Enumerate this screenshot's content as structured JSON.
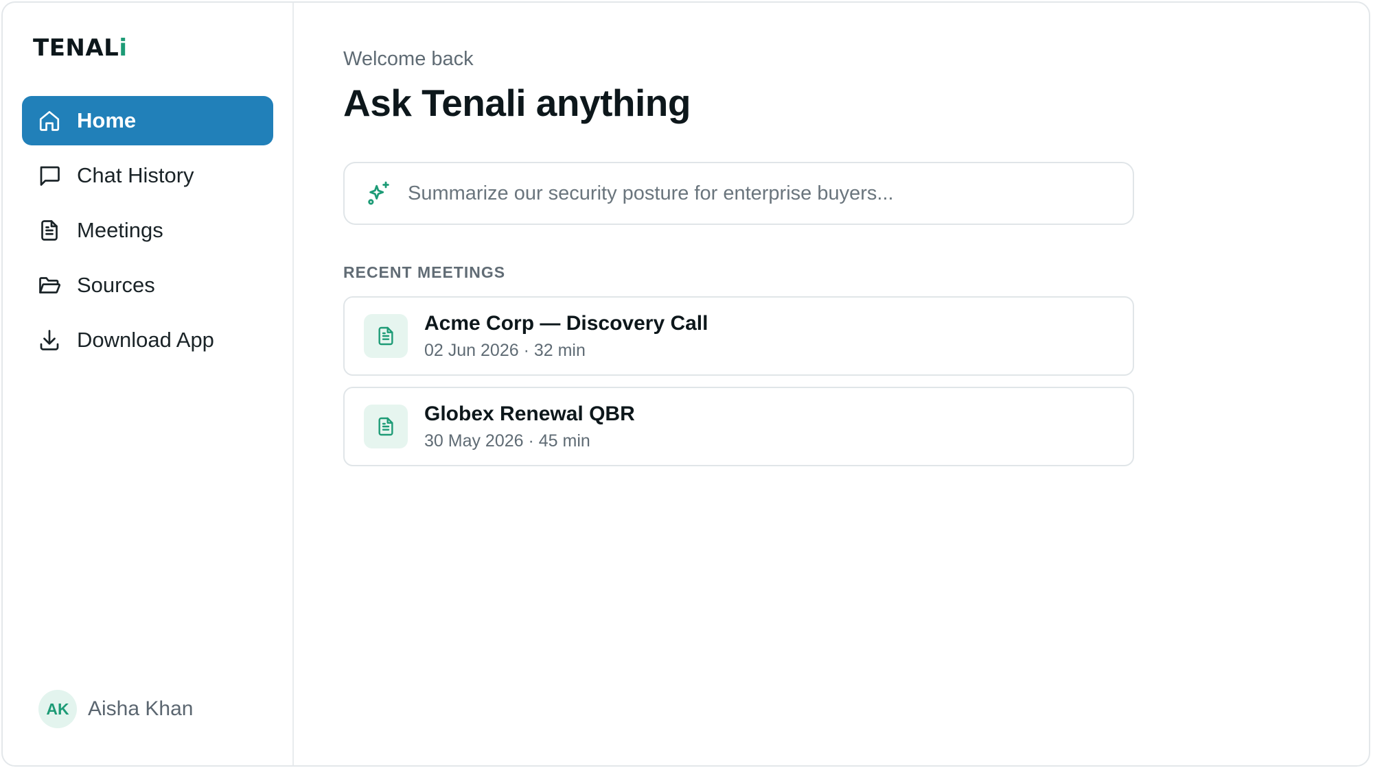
{
  "logo": {
    "text": "TENAL",
    "accent": "i"
  },
  "sidebar": {
    "items": [
      {
        "label": "Home",
        "icon": "home-icon",
        "active": true
      },
      {
        "label": "Chat History",
        "icon": "chat-icon"
      },
      {
        "label": "Meetings",
        "icon": "document-icon"
      },
      {
        "label": "Sources",
        "icon": "folder-icon"
      },
      {
        "label": "Download App",
        "icon": "download-icon"
      }
    ]
  },
  "user": {
    "initials": "AK",
    "name": "Aisha Khan"
  },
  "main": {
    "welcome": "Welcome back",
    "title": "Ask Tenali anything",
    "ask": {
      "placeholder": "Summarize our security posture for enterprise buyers...",
      "icon": "sparkle-icon"
    },
    "recent_label": "RECENT MEETINGS",
    "meetings": [
      {
        "title": "Acme Corp — Discovery Call",
        "meta": "02 Jun 2026 · 32 min",
        "icon": "document-icon"
      },
      {
        "title": "Globex Renewal QBR",
        "meta": "30 May 2026 · 45 min",
        "icon": "document-icon"
      }
    ]
  },
  "colors": {
    "primary": "#2180b9",
    "accent": "#1d9b76",
    "border": "#e0e5e8",
    "muted_text": "#5f6b74"
  }
}
